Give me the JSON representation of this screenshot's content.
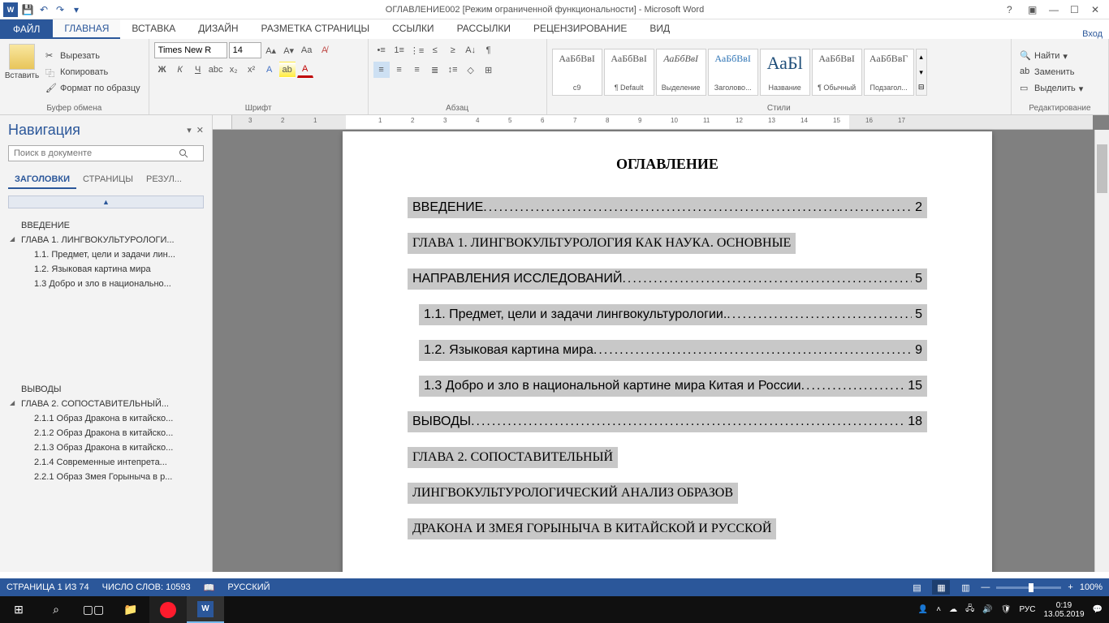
{
  "titlebar": {
    "title": "ОГЛАВЛЕНИЕ002 [Режим ограниченной функциональности] - Microsoft Word",
    "signin": "Вход"
  },
  "tabs": {
    "file": "ФАЙЛ",
    "items": [
      "ГЛАВНАЯ",
      "ВСТАВКА",
      "ДИЗАЙН",
      "РАЗМЕТКА СТРАНИЦЫ",
      "ССЫЛКИ",
      "РАССЫЛКИ",
      "РЕЦЕНЗИРОВАНИЕ",
      "ВИД"
    ]
  },
  "ribbon": {
    "clipboard": {
      "paste": "Вставить",
      "cut": "Вырезать",
      "copy": "Копировать",
      "format": "Формат по образцу",
      "label": "Буфер обмена"
    },
    "font": {
      "name": "Times New R",
      "size": "14",
      "label": "Шрифт"
    },
    "paragraph": {
      "label": "Абзац"
    },
    "styles": {
      "label": "Стили",
      "items": [
        {
          "preview": "АаБбВвІ",
          "name": "с9"
        },
        {
          "preview": "АаБбВвІ",
          "name": "¶ Default"
        },
        {
          "preview": "АаБбВвІ",
          "name": "Выделение"
        },
        {
          "preview": "АаБбВвІ",
          "name": "Заголово..."
        },
        {
          "preview": "АаБl",
          "name": "Название"
        },
        {
          "preview": "АаБбВвІ",
          "name": "¶ Обычный"
        },
        {
          "preview": "АаБбВвГ",
          "name": "Подзагол..."
        }
      ]
    },
    "editing": {
      "find": "Найти",
      "replace": "Заменить",
      "select": "Выделить",
      "label": "Редактирование"
    }
  },
  "nav": {
    "title": "Навигация",
    "search_placeholder": "Поиск в документе",
    "tabs": [
      "ЗАГОЛОВКИ",
      "СТРАНИЦЫ",
      "РЕЗУЛ..."
    ],
    "tree": [
      {
        "level": "h1",
        "text": "ВВЕДЕНИЕ"
      },
      {
        "level": "h1",
        "text": "ГЛАВА 1. ЛИНГВОКУЛЬТУРОЛОГИ...",
        "expandable": true
      },
      {
        "level": "h2",
        "text": "1.1. Предмет, цели и задачи лин..."
      },
      {
        "level": "h2",
        "text": "1.2. Языковая картина мира"
      },
      {
        "level": "h2",
        "text": "1.3 Добро и зло в национально..."
      }
    ],
    "tree2": [
      {
        "level": "h1",
        "text": "ВЫВОДЫ"
      },
      {
        "level": "h1",
        "text": "ГЛАВА 2.  СОПОСТАВИТЕЛЬНЫЙ...",
        "expandable": true
      },
      {
        "level": "h2",
        "text": "2.1.1 Образ Дракона в китайско..."
      },
      {
        "level": "h2",
        "text": "2.1.2  Образ Дракона в китайско..."
      },
      {
        "level": "h2",
        "text": "2.1.3 Образ Дракона в китайско..."
      },
      {
        "level": "h2",
        "text": "2.1.4 Современные интепрета..."
      },
      {
        "level": "h2",
        "text": "2.2.1  Образ Змея Горыныча в р..."
      }
    ]
  },
  "document": {
    "title": "ОГЛАВЛЕНИЕ",
    "toc": [
      {
        "type": "line",
        "text": "ВВЕДЕНИЕ",
        "page": "2"
      },
      {
        "type": "chapter",
        "lines": [
          "ГЛАВА 1. ЛИНГВОКУЛЬТУРОЛОГИЯ КАК НАУКА. ОСНОВНЫЕ"
        ],
        "last_text": "НАПРАВЛЕНИЯ ИССЛЕДОВАНИЙ ",
        "page": "5"
      },
      {
        "type": "line",
        "indent": true,
        "text": "1.1. Предмет, цели и задачи лингвокультурологии. ",
        "page": "5"
      },
      {
        "type": "line",
        "indent": true,
        "text": "1.2. Языковая картина мира ",
        "page": "9"
      },
      {
        "type": "line",
        "indent": true,
        "text": "1.3 Добро и зло в национальной картине мира Китая и России",
        "page": "15"
      },
      {
        "type": "line",
        "text": "ВЫВОДЫ",
        "page": "18"
      },
      {
        "type": "chapter",
        "lines": [
          "ГЛАВА 2.    СОПОСТАВИТЕЛЬНЫЙ",
          "ЛИНГВОКУЛЬТУРОЛОГИЧЕСКИЙ АНАЛИЗ ОБРАЗОВ",
          "ДРАКОНА И ЗМЕЯ ГОРЫНЫЧА В КИТАЙСКОЙ И РУССКОЙ"
        ]
      }
    ]
  },
  "ruler": {
    "ticks": [
      "3",
      "2",
      "1",
      "1",
      "2",
      "3",
      "4",
      "5",
      "6",
      "7",
      "8",
      "9",
      "10",
      "11",
      "12",
      "13",
      "14",
      "15",
      "16",
      "17"
    ]
  },
  "status": {
    "page": "СТРАНИЦА 1 ИЗ 74",
    "words": "ЧИСЛО СЛОВ: 10593",
    "lang": "РУССКИЙ",
    "zoom": "100%"
  },
  "taskbar": {
    "lang": "РУС",
    "time": "0:19",
    "date": "13.05.2019"
  }
}
